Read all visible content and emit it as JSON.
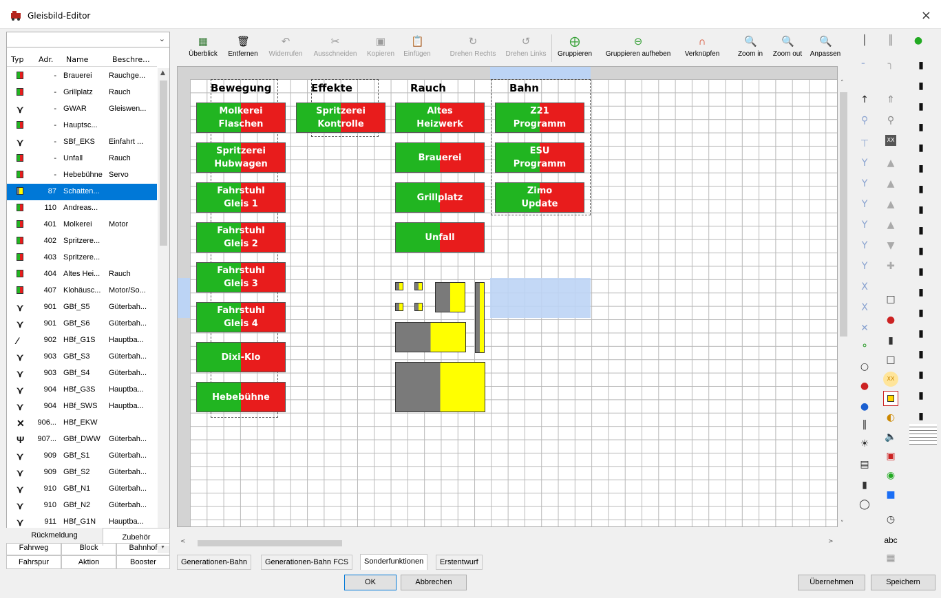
{
  "window": {
    "title": "Gleisbild-Editor",
    "close": "×"
  },
  "left": {
    "combo_value": "",
    "headers": {
      "typ": "Typ",
      "adr": "Adr.",
      "name": "Name",
      "desc": "Beschre..."
    },
    "rows": [
      {
        "t": "rg",
        "adr": "-",
        "name": "Brauerei",
        "desc": "Rauchge..."
      },
      {
        "t": "rg",
        "adr": "-",
        "name": "Grillplatz",
        "desc": "Rauch"
      },
      {
        "t": "sw",
        "adr": "-",
        "name": "GWAR",
        "desc": "Gleiswen..."
      },
      {
        "t": "rg",
        "adr": "-",
        "name": "Hauptsc...",
        "desc": ""
      },
      {
        "t": "sw",
        "adr": "-",
        "name": "SBf_EKS",
        "desc": "Einfahrt ..."
      },
      {
        "t": "rg",
        "adr": "-",
        "name": "Unfall",
        "desc": "Rauch"
      },
      {
        "t": "rg",
        "adr": "-",
        "name": "Hebebühne",
        "desc": "Servo"
      },
      {
        "t": "gy",
        "adr": "87",
        "name": "Schatten...",
        "desc": "",
        "sel": true
      },
      {
        "t": "rg",
        "adr": "110",
        "name": "Andreas...",
        "desc": ""
      },
      {
        "t": "rg",
        "adr": "401",
        "name": "Molkerei",
        "desc": "Motor"
      },
      {
        "t": "rg",
        "adr": "402",
        "name": "Spritzere...",
        "desc": ""
      },
      {
        "t": "rg",
        "adr": "403",
        "name": "Spritzere...",
        "desc": ""
      },
      {
        "t": "rg",
        "adr": "404",
        "name": "Altes Hei...",
        "desc": "Rauch"
      },
      {
        "t": "rg",
        "adr": "407",
        "name": "Klohäusc...",
        "desc": "Motor/So..."
      },
      {
        "t": "sw",
        "adr": "901",
        "name": "GBf_S5",
        "desc": "Güterbah..."
      },
      {
        "t": "sw",
        "adr": "901",
        "name": "GBf_S6",
        "desc": "Güterbah..."
      },
      {
        "t": "sw2",
        "adr": "902",
        "name": "HBf_G1S",
        "desc": "Hauptba..."
      },
      {
        "t": "sw",
        "adr": "903",
        "name": "GBf_S3",
        "desc": "Güterbah..."
      },
      {
        "t": "sw",
        "adr": "903",
        "name": "GBf_S4",
        "desc": "Güterbah..."
      },
      {
        "t": "sw3",
        "adr": "904",
        "name": "HBf_G3S",
        "desc": "Hauptba..."
      },
      {
        "t": "sw3",
        "adr": "904",
        "name": "HBf_SWS",
        "desc": "Hauptba..."
      },
      {
        "t": "sw4",
        "adr": "906...",
        "name": "HBf_EKW",
        "desc": ""
      },
      {
        "t": "sw5",
        "adr": "907...",
        "name": "GBf_DWW",
        "desc": "Güterbah..."
      },
      {
        "t": "sw3",
        "adr": "909",
        "name": "GBf_S1",
        "desc": "Güterbah..."
      },
      {
        "t": "sw3",
        "adr": "909",
        "name": "GBf_S2",
        "desc": "Güterbah..."
      },
      {
        "t": "sw3",
        "adr": "910",
        "name": "GBf_N1",
        "desc": "Güterbah..."
      },
      {
        "t": "sw3",
        "adr": "910",
        "name": "GBf_N2",
        "desc": "Güterbah..."
      },
      {
        "t": "sw3",
        "adr": "911",
        "name": "HBf_G1N",
        "desc": "Hauptba..."
      }
    ],
    "tabs": {
      "rueckmeldung": "Rückmeldung",
      "zubehoer": "Zubehör",
      "fahrweg": "Fahrweg",
      "block": "Block",
      "bahnhof": "Bahnhof",
      "fahrspur": "Fahrspur",
      "aktion": "Aktion",
      "booster": "Booster"
    }
  },
  "toolbar": {
    "ueberblick": "Überblick",
    "entfernen": "Entfernen",
    "widerrufen": "Widerrufen",
    "ausschneiden": "Ausschneiden",
    "kopieren": "Kopieren",
    "einfuegen": "Einfügen",
    "drehen_rechts": "Drehen Rechts",
    "drehen_links": "Drehen Links",
    "gruppieren": "Gruppieren",
    "gruppieren_aufheben": "Gruppieren aufheben",
    "verknuepfen": "Verknüpfen",
    "zoom_in": "Zoom in",
    "zoom_out": "Zoom out",
    "anpassen": "Anpassen"
  },
  "canvas": {
    "groups": [
      "Bewegung",
      "Effekte",
      "Rauch",
      "Bahn"
    ],
    "bewegung": [
      "Molkerei\nFlaschen",
      "Spritzerei\nHubwagen",
      "Fahrstuhl\nGleis 1",
      "Fahrstuhl\nGleis 2",
      "Fahrstuhl\nGleis 3",
      "Fahrstuhl\nGleis 4",
      "Dixi-Klo",
      "Hebebühne"
    ],
    "effekte": [
      "Spritzerei\nKontrolle"
    ],
    "rauch": [
      "Altes\nHeizwerk",
      "Brauerei",
      "Grillplatz",
      "Unfall"
    ],
    "bahn": [
      "Z21\nProgramm",
      "ESU\nProgramm",
      "Zimo\nUpdate"
    ]
  },
  "bottom_tabs": [
    "Generationen-Bahn",
    "Generationen-Bahn FCS",
    "Sonderfunktionen",
    "Erstentwurf"
  ],
  "buttons": {
    "ok": "OK",
    "abbrechen": "Abbrechen",
    "uebernehmen": "Übernehmen",
    "speichern": "Speichern"
  },
  "palette": {
    "abc": "abc",
    "xx": "XX"
  },
  "colors": {
    "green": "#21b521",
    "red": "#e81c1c",
    "gray": "#7a7a7a",
    "yellow": "#ffff00",
    "select": "#0078d7",
    "highlight": "#bcd4f5"
  }
}
